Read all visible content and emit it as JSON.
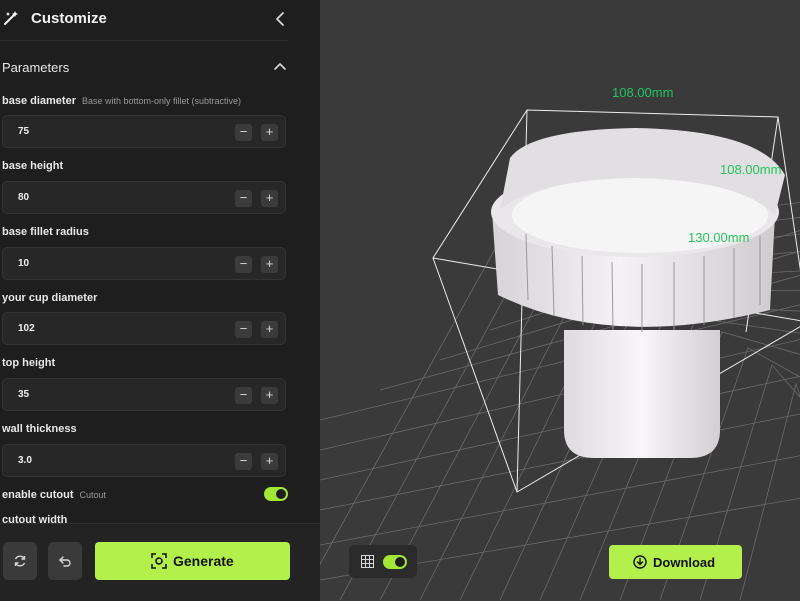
{
  "app": {
    "title": "Customize"
  },
  "parameters": {
    "section_title": "Parameters",
    "items": [
      {
        "label": "base diameter",
        "hint": "Base with bottom-only fillet (subtractive)",
        "value": "75"
      },
      {
        "label": "base height",
        "hint": "",
        "value": "80"
      },
      {
        "label": "base fillet radius",
        "hint": "",
        "value": "10"
      },
      {
        "label": "your cup diameter",
        "hint": "",
        "value": "102"
      },
      {
        "label": "top height",
        "hint": "",
        "value": "35"
      },
      {
        "label": "wall thickness",
        "hint": "",
        "value": "3.0"
      }
    ],
    "toggle": {
      "label": "enable cutout",
      "hint": "Cutout",
      "checked": true
    },
    "next_label": "cutout width",
    "step_minus": "−",
    "step_plus": "+"
  },
  "footer": {
    "generate_label": "Generate"
  },
  "viewport": {
    "grid_enabled": true,
    "download_label": "Download",
    "dimensions": {
      "width": "108.00mm",
      "depth": "108.00mm",
      "height": "130.00mm"
    }
  },
  "colors": {
    "accent": "#b4f04c",
    "dimension": "#22c55e",
    "sidebar_bg": "#1e1e1e",
    "viewport_bg": "#3a3a3a"
  }
}
